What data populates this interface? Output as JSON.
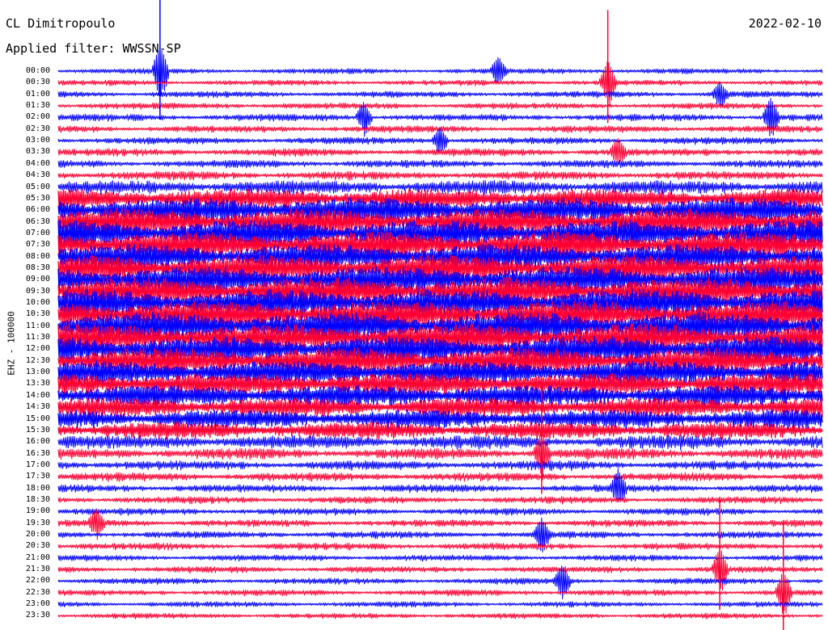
{
  "header": {
    "station": "CL Dimitropoulo",
    "filter": "Applied filter: WWSSN-SP",
    "date": "2022-02-10"
  },
  "chart_data": {
    "type": "line",
    "ylabel": "EHZ - 100000",
    "row_labels": [
      "00:00",
      "00:30",
      "01:00",
      "01:30",
      "02:00",
      "02:30",
      "03:00",
      "03:30",
      "04:00",
      "04:30",
      "05:00",
      "05:30",
      "06:00",
      "06:30",
      "07:00",
      "07:30",
      "08:00",
      "08:30",
      "09:00",
      "09:30",
      "10:00",
      "10:30",
      "11:00",
      "11:30",
      "12:00",
      "12:30",
      "13:00",
      "13:30",
      "14:00",
      "14:30",
      "15:00",
      "15:30",
      "16:00",
      "16:30",
      "17:00",
      "17:30",
      "18:00",
      "18:30",
      "19:00",
      "19:30",
      "20:00",
      "20:30",
      "21:00",
      "21:30",
      "22:00",
      "22:30",
      "23:00",
      "23:30"
    ],
    "trace_colors": [
      "#0000ff",
      "#ff0033"
    ],
    "noise_level": [
      0.35,
      0.35,
      0.4,
      0.4,
      0.45,
      0.45,
      0.45,
      0.5,
      0.5,
      0.55,
      0.9,
      1.3,
      1.7,
      1.8,
      1.8,
      1.8,
      1.7,
      1.8,
      1.8,
      1.9,
      1.9,
      1.9,
      1.9,
      1.9,
      1.8,
      1.8,
      1.6,
      1.5,
      1.4,
      1.3,
      1.2,
      1.1,
      0.9,
      0.7,
      0.6,
      0.55,
      0.5,
      0.45,
      0.45,
      0.45,
      0.45,
      0.45,
      0.4,
      0.4,
      0.4,
      0.4,
      0.35,
      0.35
    ],
    "events": [
      {
        "row": 0,
        "minute": 4.0,
        "amp": 6.0
      },
      {
        "row": 0,
        "minute": 17.3,
        "amp": 3.0
      },
      {
        "row": 1,
        "minute": 21.6,
        "amp": 5.0
      },
      {
        "row": 2,
        "minute": 26.0,
        "amp": 2.5
      },
      {
        "row": 4,
        "minute": 12.0,
        "amp": 3.5
      },
      {
        "row": 4,
        "minute": 28.0,
        "amp": 4.5
      },
      {
        "row": 6,
        "minute": 15.0,
        "amp": 3.0
      },
      {
        "row": 7,
        "minute": 22.0,
        "amp": 3.0
      },
      {
        "row": 33,
        "minute": 19.0,
        "amp": 5.0
      },
      {
        "row": 36,
        "minute": 22.0,
        "amp": 4.0
      },
      {
        "row": 39,
        "minute": 1.5,
        "amp": 3.0
      },
      {
        "row": 40,
        "minute": 19.0,
        "amp": 3.5
      },
      {
        "row": 43,
        "minute": 26.0,
        "amp": 5.0
      },
      {
        "row": 44,
        "minute": 19.8,
        "amp": 3.5
      },
      {
        "row": 45,
        "minute": 28.5,
        "amp": 5.0
      }
    ]
  }
}
